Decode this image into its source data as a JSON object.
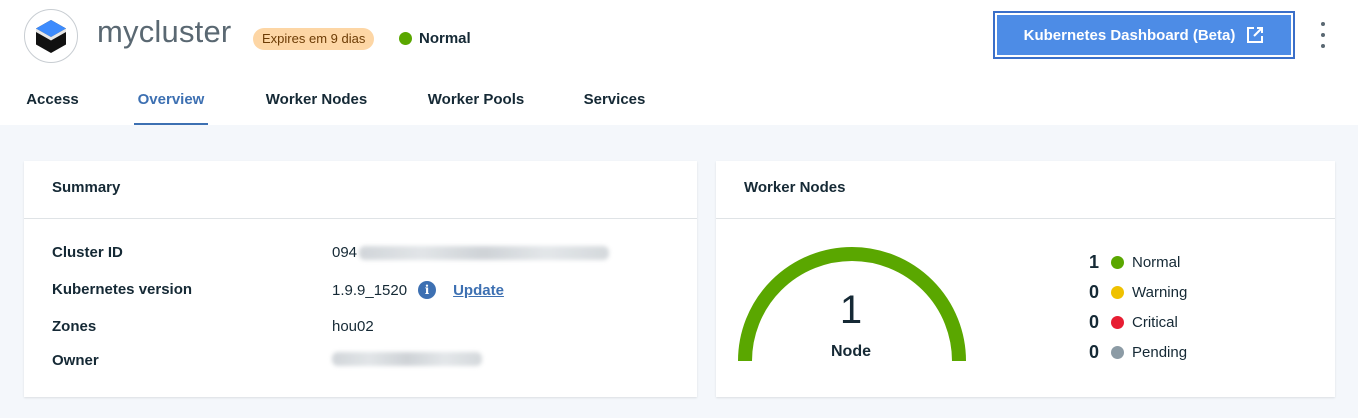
{
  "header": {
    "title": "mycluster",
    "expires_badge": "Expires em 9 dias",
    "status": "Normal",
    "dashboard_button": "Kubernetes Dashboard (Beta)"
  },
  "tabs": [
    {
      "label": "Access"
    },
    {
      "label": "Overview",
      "active": true
    },
    {
      "label": "Worker Nodes"
    },
    {
      "label": "Worker Pools"
    },
    {
      "label": "Services"
    }
  ],
  "summary": {
    "title": "Summary",
    "rows": [
      {
        "label": "Cluster ID",
        "value": "094"
      },
      {
        "label": "Kubernetes version",
        "value": "1.9.9_1520",
        "link": "Update"
      },
      {
        "label": "Zones",
        "value": "hou02"
      },
      {
        "label": "Owner",
        "value": ""
      }
    ]
  },
  "worker_nodes": {
    "title": "Worker Nodes",
    "gauge_count": "1",
    "gauge_label": "Node",
    "legend": [
      {
        "count": "1",
        "label": "Normal",
        "color": "#5aa700"
      },
      {
        "count": "0",
        "label": "Warning",
        "color": "#efc100"
      },
      {
        "count": "0",
        "label": "Critical",
        "color": "#e71d32"
      },
      {
        "count": "0",
        "label": "Pending",
        "color": "#8c9ba5"
      }
    ]
  },
  "colors": {
    "accent": "#3d70b2",
    "button": "#4d8ce6",
    "normal": "#5aa700",
    "badge_bg": "#fdd6a5"
  },
  "icons": [
    "cluster-logo-icon",
    "external-link-icon",
    "overflow-menu-icon",
    "info-icon"
  ]
}
